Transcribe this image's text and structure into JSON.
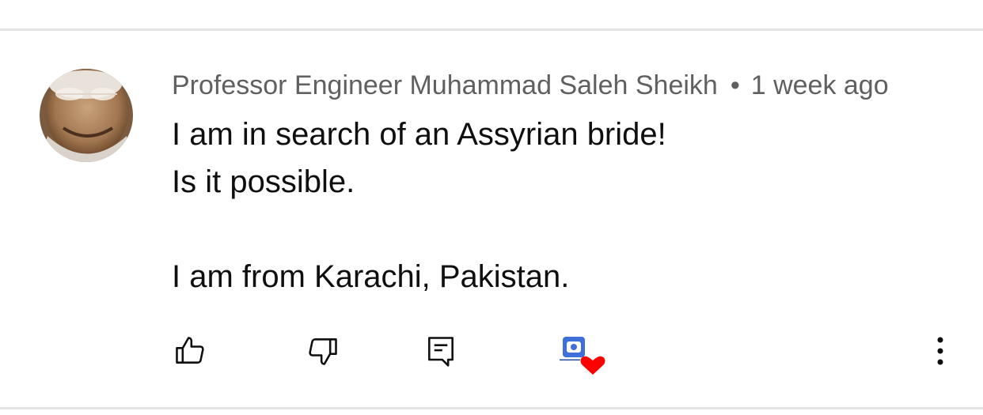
{
  "comment": {
    "author": "Professor Engineer Muhammad Saleh Sheikh",
    "separator": "•",
    "timestamp": "1 week ago",
    "lines": [
      "I am in search of an Assyrian bride!",
      "Is it possible.",
      "",
      "I am from Karachi, Pakistan."
    ]
  },
  "actions": {
    "like_icon": "thumbs-up-icon",
    "dislike_icon": "thumbs-down-icon",
    "reply_icon": "reply-icon",
    "creator_heart_icon": "creator-heart-icon",
    "more_icon": "more-vertical-icon"
  },
  "colors": {
    "text_primary": "#0f0f0f",
    "text_secondary": "#606060",
    "divider": "#e5e5e5",
    "heart": "#ff0000",
    "badge_blue": "#3f6fd8"
  }
}
